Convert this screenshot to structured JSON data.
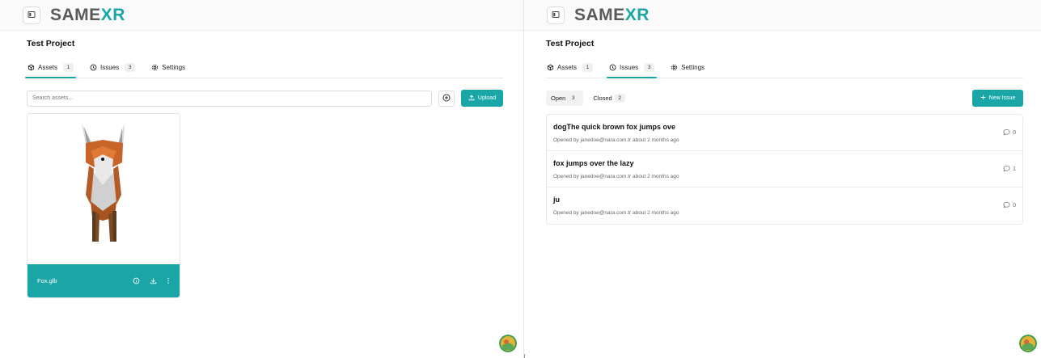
{
  "app": {
    "logo_same": "SAME",
    "logo_xr": "XR"
  },
  "left": {
    "project_title": "Test Project",
    "tabs": [
      {
        "label": "Assets",
        "count": "1",
        "icon": "asset-icon",
        "active": true
      },
      {
        "label": "Issues",
        "count": "3",
        "icon": "issue-icon",
        "active": false
      },
      {
        "label": "Settings",
        "icon": "gear-icon",
        "active": false
      }
    ],
    "search": {
      "placeholder": "Search assets...",
      "value": ""
    },
    "upload_label": "Upload",
    "asset": {
      "name": "Fox.glb"
    }
  },
  "right": {
    "project_title": "Test Project",
    "tabs": [
      {
        "label": "Assets",
        "count": "1",
        "icon": "asset-icon",
        "active": false
      },
      {
        "label": "Issues",
        "count": "3",
        "icon": "issue-icon",
        "active": true
      },
      {
        "label": "Settings",
        "icon": "gear-icon",
        "active": false
      }
    ],
    "filters": [
      {
        "label": "Open",
        "count": "3",
        "active": true
      },
      {
        "label": "Closed",
        "count": "2",
        "active": false
      }
    ],
    "new_issue_label": "New Issue",
    "issues": [
      {
        "title": "dogThe quick brown fox jumps ove",
        "meta": "Opened by janedoe@nara.com.tr about 2 months ago",
        "comments": "0"
      },
      {
        "title": "fox jumps over the lazy",
        "meta": "Opened by janedoe@nara.com.tr about 2 months ago",
        "comments": "1"
      },
      {
        "title": "ju",
        "meta": "Opened by janedoe@nara.com.tr about 2 months ago",
        "comments": "0"
      }
    ]
  },
  "colors": {
    "accent": "#1aa6a6",
    "logo_gray": "#5a5a5a"
  }
}
